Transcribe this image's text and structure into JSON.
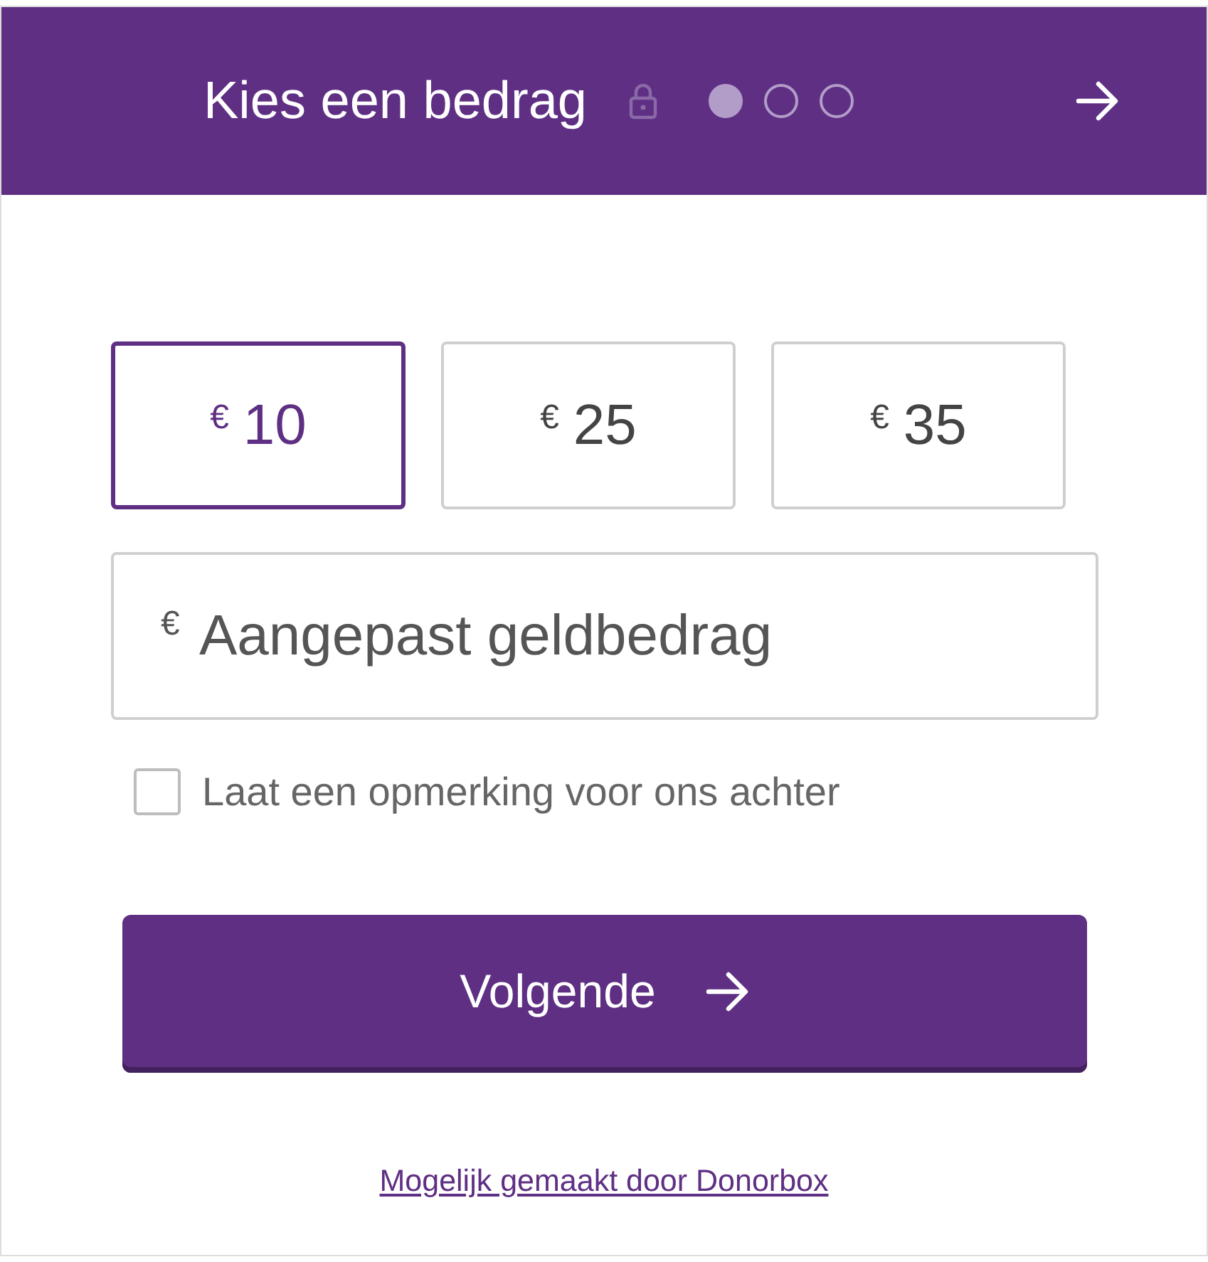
{
  "header": {
    "title": "Kies een bedrag",
    "steps": [
      {
        "selected": true
      },
      {
        "selected": false
      },
      {
        "selected": false
      }
    ]
  },
  "amounts": [
    {
      "currency": "€",
      "value": "10",
      "selected": true
    },
    {
      "currency": "€",
      "value": "25",
      "selected": false
    },
    {
      "currency": "€",
      "value": "35",
      "selected": false
    }
  ],
  "custom_amount": {
    "currency": "€",
    "placeholder": "Aangepast geldbedrag"
  },
  "comment_option": {
    "label": "Laat een opmerking voor ons achter",
    "checked": false
  },
  "next_button": {
    "label": "Volgende"
  },
  "footer_link": "Mogelijk gemaakt door Donorbox"
}
